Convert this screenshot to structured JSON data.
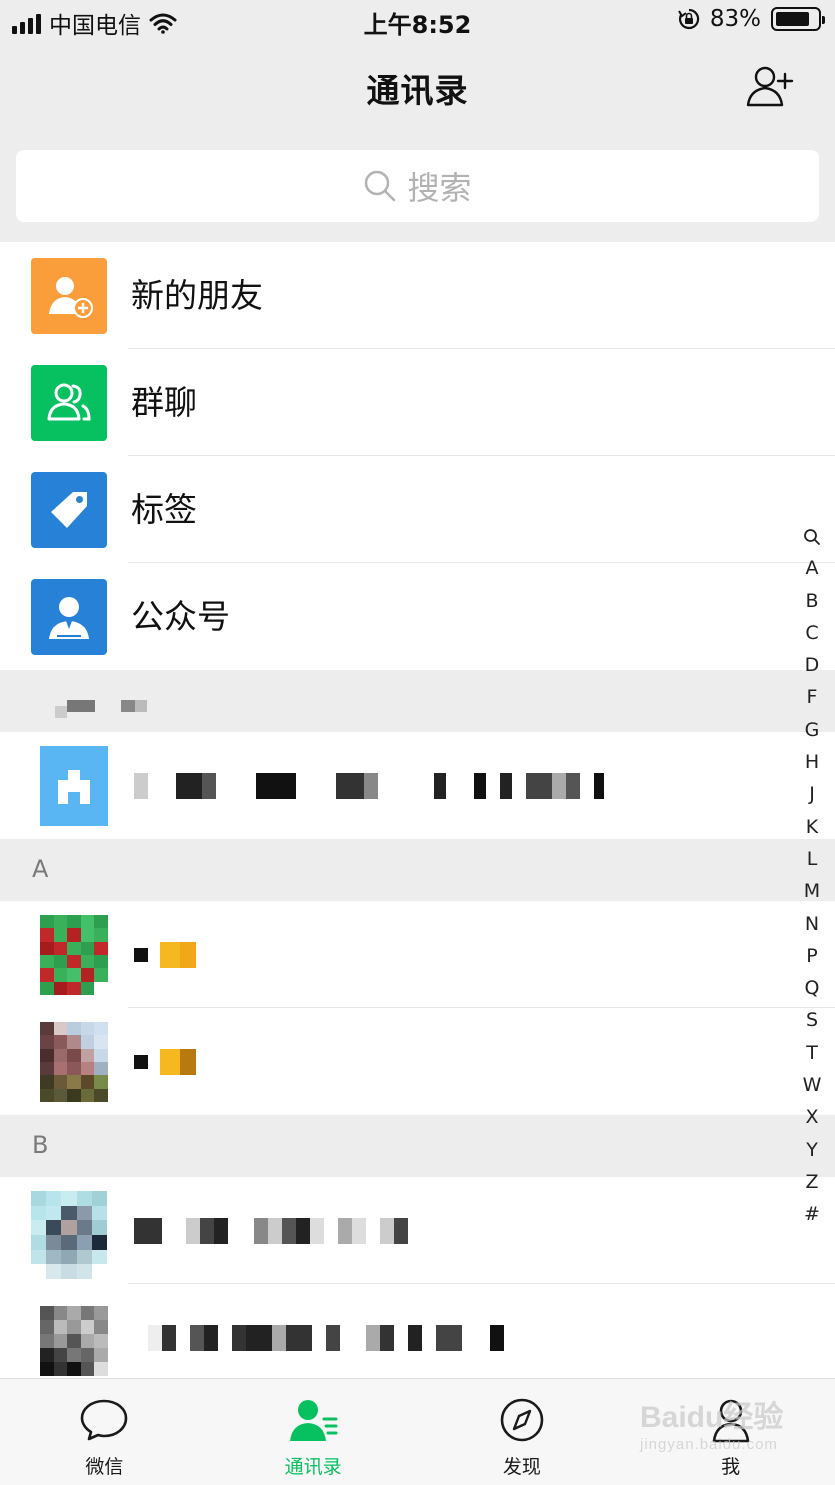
{
  "status_bar": {
    "carrier": "中国电信",
    "time": "上午8:52",
    "battery": "83%",
    "battery_level": 0.83
  },
  "nav": {
    "title": "通讯录",
    "add_icon": "add-contact-icon"
  },
  "search": {
    "placeholder": "搜索"
  },
  "features": [
    {
      "label": "新的朋友",
      "icon": "new-friend-icon",
      "color": "#fa9d3b"
    },
    {
      "label": "群聊",
      "icon": "group-chat-icon",
      "color": "#07c160"
    },
    {
      "label": "标签",
      "icon": "tag-icon",
      "color": "#2782d7"
    },
    {
      "label": "公众号",
      "icon": "official-account-icon",
      "color": "#2782d7"
    }
  ],
  "sections": [
    {
      "letter": "A"
    },
    {
      "letter": "B"
    }
  ],
  "index_letters": [
    "A",
    "B",
    "C",
    "D",
    "F",
    "G",
    "H",
    "J",
    "K",
    "L",
    "M",
    "N",
    "P",
    "Q",
    "S",
    "T",
    "W",
    "X",
    "Y",
    "Z",
    "#"
  ],
  "tabs": [
    {
      "label": "微信",
      "icon": "chat-bubble-icon",
      "active": false
    },
    {
      "label": "通讯录",
      "icon": "contacts-icon",
      "active": true
    },
    {
      "label": "发现",
      "icon": "compass-icon",
      "active": false
    },
    {
      "label": "我",
      "icon": "profile-icon",
      "active": false
    }
  ],
  "colors": {
    "accent": "#07c160",
    "background": "#ededed"
  },
  "watermark": {
    "brand": "Baidu经验",
    "url": "jingyan.baidu.com"
  }
}
